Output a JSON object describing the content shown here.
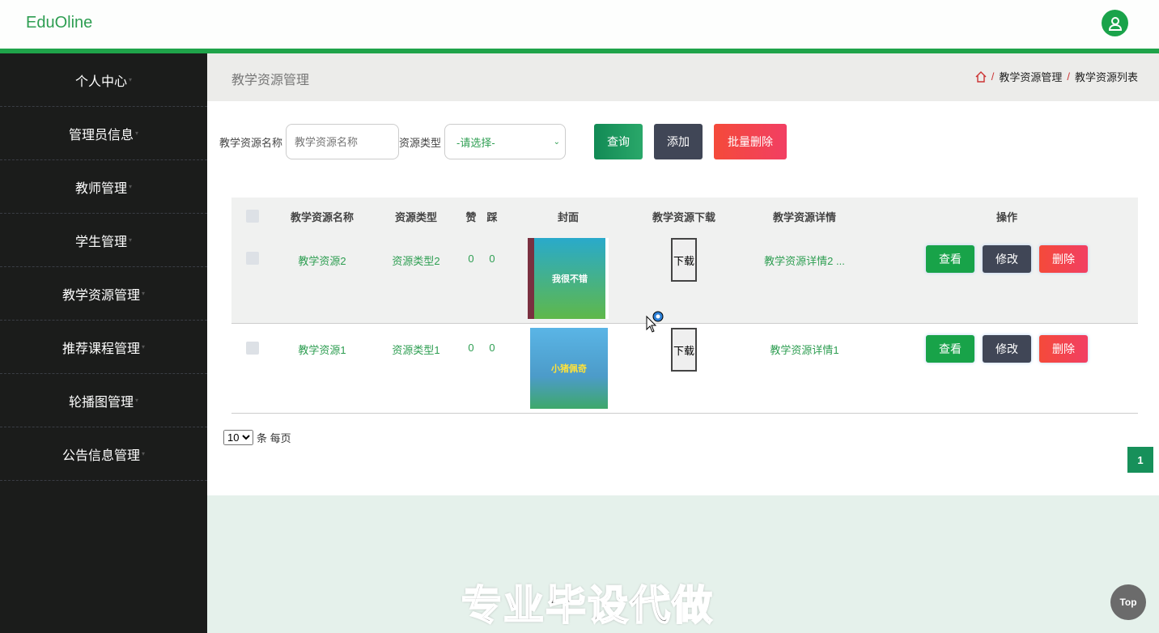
{
  "header": {
    "logo": "EduOline"
  },
  "sidebar": {
    "items": [
      {
        "label": "个人中心"
      },
      {
        "label": "管理员信息"
      },
      {
        "label": "教师管理"
      },
      {
        "label": "学生管理"
      },
      {
        "label": "教学资源管理"
      },
      {
        "label": "推荐课程管理"
      },
      {
        "label": "轮播图管理"
      },
      {
        "label": "公告信息管理"
      }
    ]
  },
  "titlebar": {
    "title": "教学资源管理",
    "breadcrumb": [
      "教学资源管理",
      "教学资源列表"
    ],
    "sep": "/"
  },
  "search": {
    "name_label": "教学资源名称",
    "name_placeholder": "教学资源名称",
    "type_label": "资源类型",
    "type_selected": "-请选择-",
    "query": "查询",
    "add": "添加",
    "batch_delete": "批量删除"
  },
  "table": {
    "headers": [
      "教学资源名称",
      "资源类型",
      "赞",
      "踩",
      "封面",
      "教学资源下载",
      "教学资源详情",
      "操作"
    ],
    "rows": [
      {
        "name": "教学资源2",
        "type": "资源类型2",
        "likes": "0",
        "dislikes": "0",
        "cover_text": "我很不错",
        "download": "下载",
        "detail": "教学资源详情2 ...",
        "view": "查看",
        "edit": "修改",
        "delete": "删除"
      },
      {
        "name": "教学资源1",
        "type": "资源类型1",
        "likes": "0",
        "dislikes": "0",
        "cover_text": "小猪佩奇",
        "download": "下载",
        "detail": "教学资源详情1",
        "view": "查看",
        "edit": "修改",
        "delete": "删除"
      }
    ]
  },
  "pagination": {
    "page_size": "10",
    "per_page_label": "条 每页",
    "current_page": "1"
  },
  "footer": {
    "ad_text": "专业毕设代做",
    "top": "Top"
  }
}
